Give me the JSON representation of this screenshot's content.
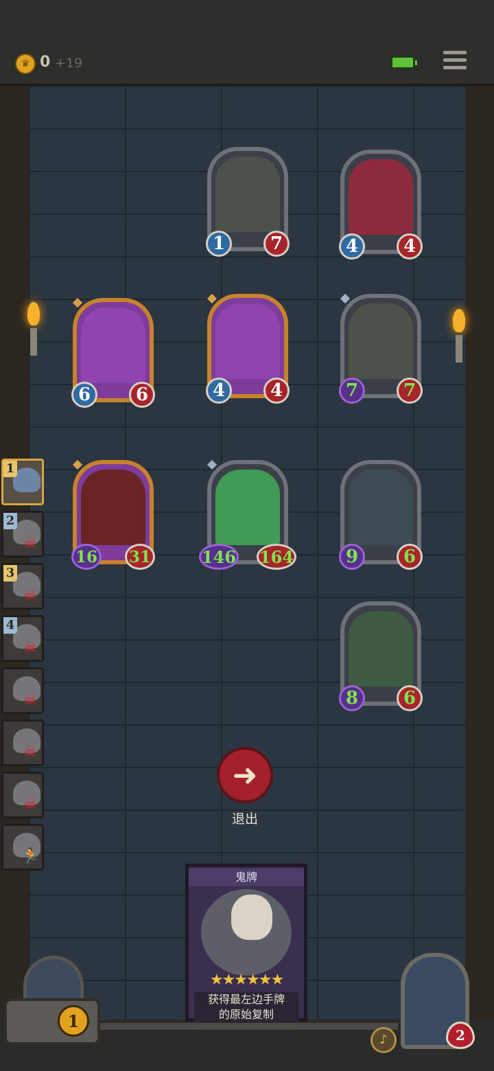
{
  "header": {
    "gold": "0",
    "gold_income": "+19",
    "icons": {
      "coin": "crown-coin-icon",
      "battery": "battery-icon",
      "menu": "hamburger-menu-icon"
    }
  },
  "board": {
    "enemy_cards": [
      {
        "name": "enemy-card-skeleton",
        "attack": "1",
        "health": "7"
      },
      {
        "name": "enemy-card-clown",
        "attack": "4",
        "health": "4"
      }
    ],
    "row2": [
      {
        "name": "card-airship",
        "attack": "6",
        "health": "6",
        "frame": "gold"
      },
      {
        "name": "card-robot-skull",
        "attack": "4",
        "health": "4",
        "frame": "gold"
      },
      {
        "name": "card-airship-silver",
        "attack": "7",
        "health": "7",
        "frame": "silver"
      }
    ],
    "row3": [
      {
        "name": "card-ninja",
        "attack": "16",
        "health": "31",
        "frame": "gold"
      },
      {
        "name": "card-ghost-green",
        "attack": "146",
        "health": "164",
        "frame": "silver"
      },
      {
        "name": "card-demon-girl",
        "attack": "9",
        "health": "6",
        "frame": "silver"
      }
    ],
    "row4": [
      {
        "name": "card-cursed-sword",
        "attack": "8",
        "health": "6",
        "frame": "silver"
      }
    ]
  },
  "sequence": [
    {
      "index": "1",
      "status": "active"
    },
    {
      "index": "2",
      "status": "dead"
    },
    {
      "index": "3",
      "status": "dead"
    },
    {
      "index": "4",
      "status": "dead"
    },
    {
      "index": "",
      "status": "dead"
    },
    {
      "index": "",
      "status": "dead"
    },
    {
      "index": "",
      "status": "dead"
    },
    {
      "index": "",
      "status": "fled"
    }
  ],
  "exit": {
    "label": "退出",
    "icon": "arrow-left-icon"
  },
  "event_card": {
    "title": "鬼牌",
    "stars": "★★★★★★",
    "desc_line1": "获得最左边手牌",
    "desc_line2": "的原始复制"
  },
  "player": {
    "gold": "1",
    "health": "2"
  },
  "colors": {
    "attack": "#2f6aa3",
    "health": "#a8242b",
    "buff_text": "#7ee54d",
    "gold_frame": "#c8812c"
  }
}
